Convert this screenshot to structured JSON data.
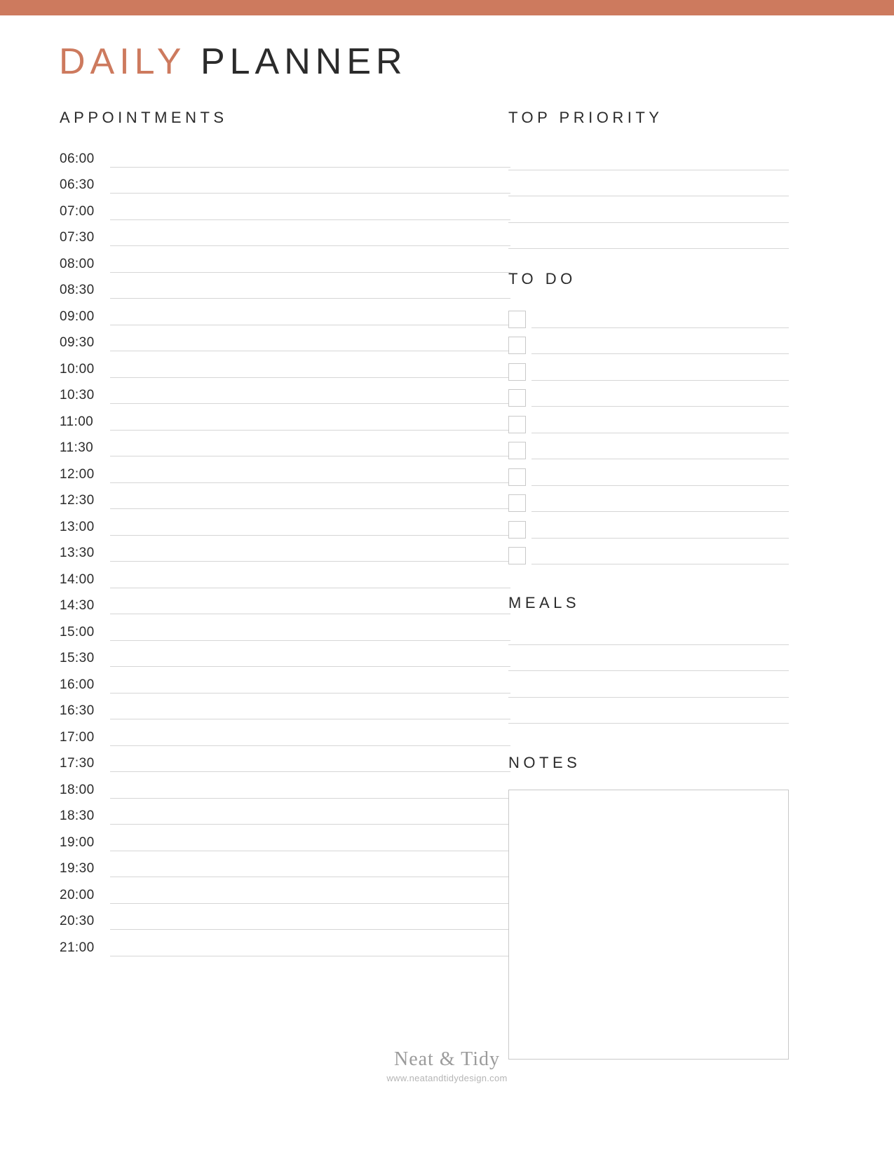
{
  "theme": {
    "accent_color": "#cd7a5e",
    "text_color": "#2b2b2b",
    "rule_color": "#d6d6d6",
    "box_border_color": "#c9c9c9",
    "footer_color": "#9b9b9b"
  },
  "title": {
    "part1": "DAILY",
    "part2": "PLANNER"
  },
  "sections": {
    "appointments": {
      "heading": "APPOINTMENTS",
      "times": [
        "06:00",
        "06:30",
        "07:00",
        "07:30",
        "08:00",
        "08:30",
        "09:00",
        "09:30",
        "10:00",
        "10:30",
        "11:00",
        "11:30",
        "12:00",
        "12:30",
        "13:00",
        "13:30",
        "14:00",
        "14:30",
        "15:00",
        "15:30",
        "16:00",
        "16:30",
        "17:00",
        "17:30",
        "18:00",
        "18:30",
        "19:00",
        "19:30",
        "20:00",
        "20:30",
        "21:00"
      ]
    },
    "top_priority": {
      "heading": "TOP PRIORITY",
      "line_count": 4,
      "values": [
        "",
        "",
        "",
        ""
      ]
    },
    "to_do": {
      "heading": "TO DO",
      "item_count": 10,
      "items": [
        {
          "checked": false,
          "value": ""
        },
        {
          "checked": false,
          "value": ""
        },
        {
          "checked": false,
          "value": ""
        },
        {
          "checked": false,
          "value": ""
        },
        {
          "checked": false,
          "value": ""
        },
        {
          "checked": false,
          "value": ""
        },
        {
          "checked": false,
          "value": ""
        },
        {
          "checked": false,
          "value": ""
        },
        {
          "checked": false,
          "value": ""
        },
        {
          "checked": false,
          "value": ""
        }
      ]
    },
    "meals": {
      "heading": "MEALS",
      "line_count": 4,
      "values": [
        "",
        "",
        "",
        ""
      ]
    },
    "notes": {
      "heading": "NOTES",
      "value": ""
    }
  },
  "footer": {
    "brand": "Neat & Tidy",
    "url": "www.neatandtidydesign.com"
  }
}
